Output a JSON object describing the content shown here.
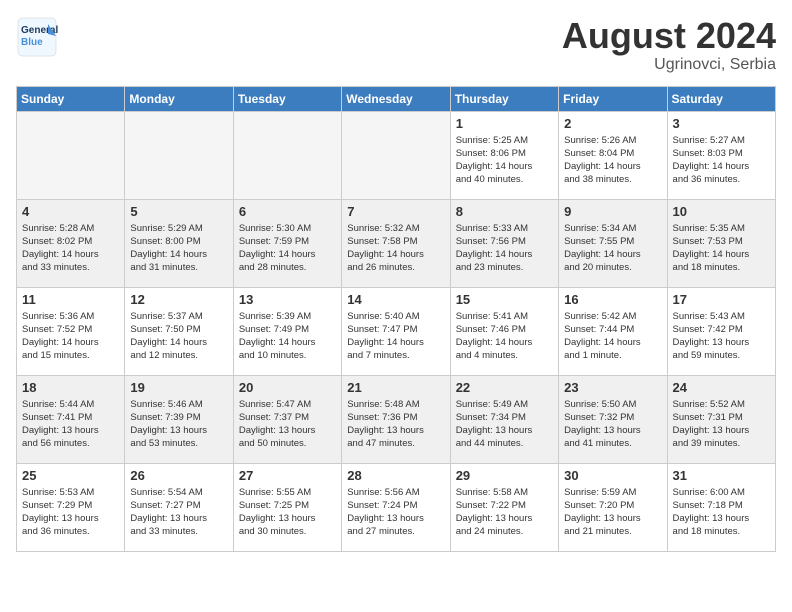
{
  "header": {
    "logo_line1": "General",
    "logo_line2": "Blue",
    "month_year": "August 2024",
    "location": "Ugrinovci, Serbia"
  },
  "weekdays": [
    "Sunday",
    "Monday",
    "Tuesday",
    "Wednesday",
    "Thursday",
    "Friday",
    "Saturday"
  ],
  "weeks": [
    [
      {
        "day": "",
        "info": "",
        "empty": true
      },
      {
        "day": "",
        "info": "",
        "empty": true
      },
      {
        "day": "",
        "info": "",
        "empty": true
      },
      {
        "day": "",
        "info": "",
        "empty": true
      },
      {
        "day": "1",
        "info": "Sunrise: 5:25 AM\nSunset: 8:06 PM\nDaylight: 14 hours\nand 40 minutes.",
        "empty": false
      },
      {
        "day": "2",
        "info": "Sunrise: 5:26 AM\nSunset: 8:04 PM\nDaylight: 14 hours\nand 38 minutes.",
        "empty": false
      },
      {
        "day": "3",
        "info": "Sunrise: 5:27 AM\nSunset: 8:03 PM\nDaylight: 14 hours\nand 36 minutes.",
        "empty": false
      }
    ],
    [
      {
        "day": "4",
        "info": "Sunrise: 5:28 AM\nSunset: 8:02 PM\nDaylight: 14 hours\nand 33 minutes.",
        "empty": false
      },
      {
        "day": "5",
        "info": "Sunrise: 5:29 AM\nSunset: 8:00 PM\nDaylight: 14 hours\nand 31 minutes.",
        "empty": false
      },
      {
        "day": "6",
        "info": "Sunrise: 5:30 AM\nSunset: 7:59 PM\nDaylight: 14 hours\nand 28 minutes.",
        "empty": false
      },
      {
        "day": "7",
        "info": "Sunrise: 5:32 AM\nSunset: 7:58 PM\nDaylight: 14 hours\nand 26 minutes.",
        "empty": false
      },
      {
        "day": "8",
        "info": "Sunrise: 5:33 AM\nSunset: 7:56 PM\nDaylight: 14 hours\nand 23 minutes.",
        "empty": false
      },
      {
        "day": "9",
        "info": "Sunrise: 5:34 AM\nSunset: 7:55 PM\nDaylight: 14 hours\nand 20 minutes.",
        "empty": false
      },
      {
        "day": "10",
        "info": "Sunrise: 5:35 AM\nSunset: 7:53 PM\nDaylight: 14 hours\nand 18 minutes.",
        "empty": false
      }
    ],
    [
      {
        "day": "11",
        "info": "Sunrise: 5:36 AM\nSunset: 7:52 PM\nDaylight: 14 hours\nand 15 minutes.",
        "empty": false
      },
      {
        "day": "12",
        "info": "Sunrise: 5:37 AM\nSunset: 7:50 PM\nDaylight: 14 hours\nand 12 minutes.",
        "empty": false
      },
      {
        "day": "13",
        "info": "Sunrise: 5:39 AM\nSunset: 7:49 PM\nDaylight: 14 hours\nand 10 minutes.",
        "empty": false
      },
      {
        "day": "14",
        "info": "Sunrise: 5:40 AM\nSunset: 7:47 PM\nDaylight: 14 hours\nand 7 minutes.",
        "empty": false
      },
      {
        "day": "15",
        "info": "Sunrise: 5:41 AM\nSunset: 7:46 PM\nDaylight: 14 hours\nand 4 minutes.",
        "empty": false
      },
      {
        "day": "16",
        "info": "Sunrise: 5:42 AM\nSunset: 7:44 PM\nDaylight: 14 hours\nand 1 minute.",
        "empty": false
      },
      {
        "day": "17",
        "info": "Sunrise: 5:43 AM\nSunset: 7:42 PM\nDaylight: 13 hours\nand 59 minutes.",
        "empty": false
      }
    ],
    [
      {
        "day": "18",
        "info": "Sunrise: 5:44 AM\nSunset: 7:41 PM\nDaylight: 13 hours\nand 56 minutes.",
        "empty": false
      },
      {
        "day": "19",
        "info": "Sunrise: 5:46 AM\nSunset: 7:39 PM\nDaylight: 13 hours\nand 53 minutes.",
        "empty": false
      },
      {
        "day": "20",
        "info": "Sunrise: 5:47 AM\nSunset: 7:37 PM\nDaylight: 13 hours\nand 50 minutes.",
        "empty": false
      },
      {
        "day": "21",
        "info": "Sunrise: 5:48 AM\nSunset: 7:36 PM\nDaylight: 13 hours\nand 47 minutes.",
        "empty": false
      },
      {
        "day": "22",
        "info": "Sunrise: 5:49 AM\nSunset: 7:34 PM\nDaylight: 13 hours\nand 44 minutes.",
        "empty": false
      },
      {
        "day": "23",
        "info": "Sunrise: 5:50 AM\nSunset: 7:32 PM\nDaylight: 13 hours\nand 41 minutes.",
        "empty": false
      },
      {
        "day": "24",
        "info": "Sunrise: 5:52 AM\nSunset: 7:31 PM\nDaylight: 13 hours\nand 39 minutes.",
        "empty": false
      }
    ],
    [
      {
        "day": "25",
        "info": "Sunrise: 5:53 AM\nSunset: 7:29 PM\nDaylight: 13 hours\nand 36 minutes.",
        "empty": false
      },
      {
        "day": "26",
        "info": "Sunrise: 5:54 AM\nSunset: 7:27 PM\nDaylight: 13 hours\nand 33 minutes.",
        "empty": false
      },
      {
        "day": "27",
        "info": "Sunrise: 5:55 AM\nSunset: 7:25 PM\nDaylight: 13 hours\nand 30 minutes.",
        "empty": false
      },
      {
        "day": "28",
        "info": "Sunrise: 5:56 AM\nSunset: 7:24 PM\nDaylight: 13 hours\nand 27 minutes.",
        "empty": false
      },
      {
        "day": "29",
        "info": "Sunrise: 5:58 AM\nSunset: 7:22 PM\nDaylight: 13 hours\nand 24 minutes.",
        "empty": false
      },
      {
        "day": "30",
        "info": "Sunrise: 5:59 AM\nSunset: 7:20 PM\nDaylight: 13 hours\nand 21 minutes.",
        "empty": false
      },
      {
        "day": "31",
        "info": "Sunrise: 6:00 AM\nSunset: 7:18 PM\nDaylight: 13 hours\nand 18 minutes.",
        "empty": false
      }
    ]
  ]
}
